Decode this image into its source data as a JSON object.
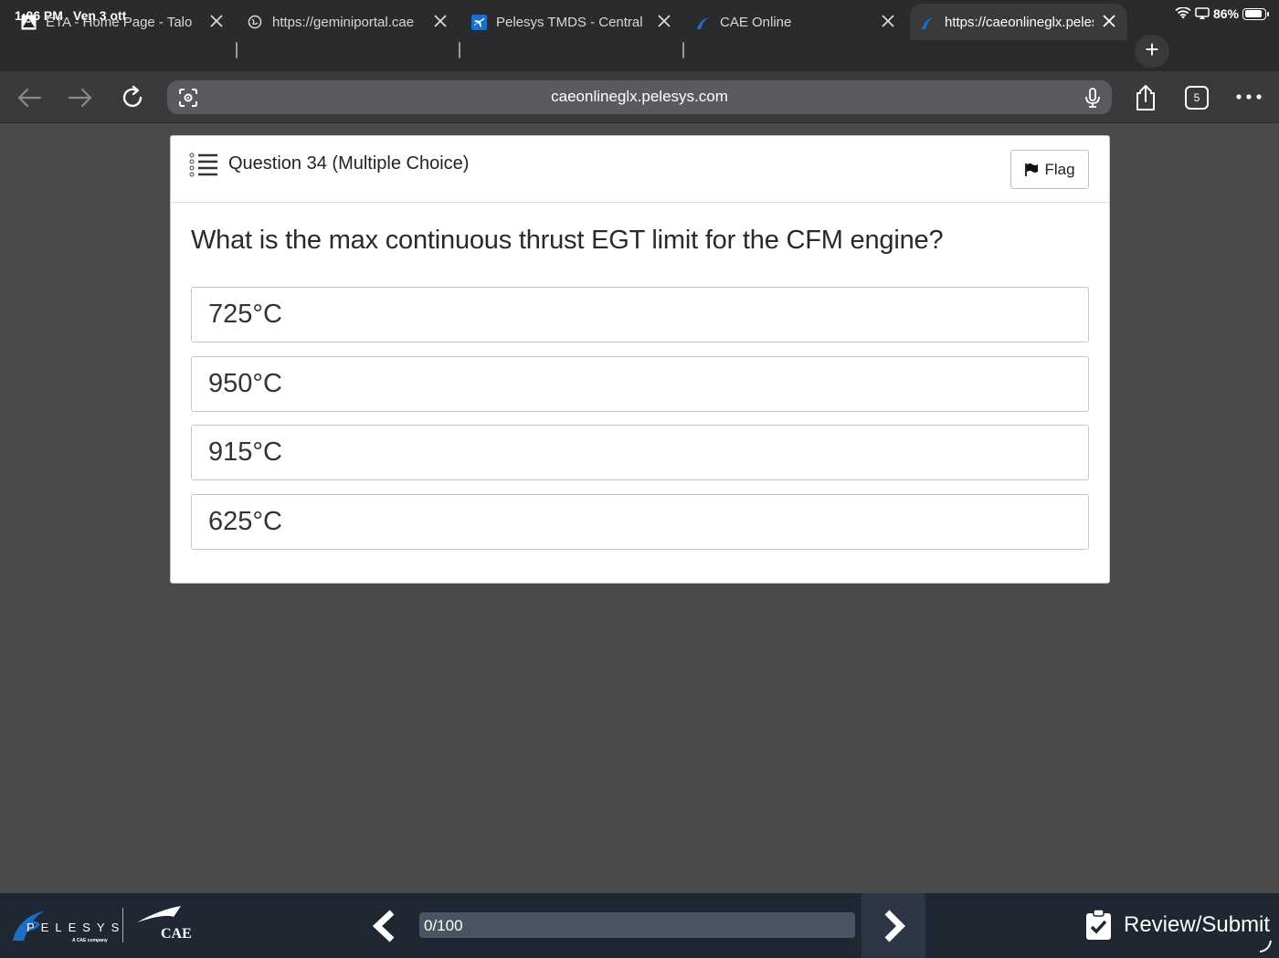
{
  "status_bar": {
    "time": "1:06 PM",
    "date": "Ven 3 ott",
    "battery": "86%",
    "battery_level": 0.86
  },
  "tabs": [
    {
      "label": "ETA - Home Page - Talon",
      "active": false
    },
    {
      "label": "https://geminiportal.cae",
      "active": false
    },
    {
      "label": "Pelesys TMDS - Central",
      "active": false
    },
    {
      "label": "CAE Online",
      "active": false
    },
    {
      "label": "https://caeonlineglx.pelesys",
      "active": true
    }
  ],
  "toolbar": {
    "url": "caeonlineglx.pelesys.com",
    "tab_count": "5"
  },
  "question_card": {
    "header": "Question 34 (Multiple Choice)",
    "flag_label": "Flag",
    "question_text": "What is the max continuous thrust EGT limit for the CFM engine?",
    "options": [
      "725°C",
      "950°C",
      "915°C",
      "625°C"
    ]
  },
  "footer": {
    "brand_pelesys": "PELESYS",
    "brand_sub": "A CAE company",
    "brand_cae": "CAE",
    "progress_text": "0/100",
    "progress_value": 0,
    "review_label": "Review/Submit"
  },
  "colors": {
    "page_background": "#4a4a4a",
    "footer_background": "#1f2733",
    "pelesys_blue": "#1a6fc9"
  }
}
